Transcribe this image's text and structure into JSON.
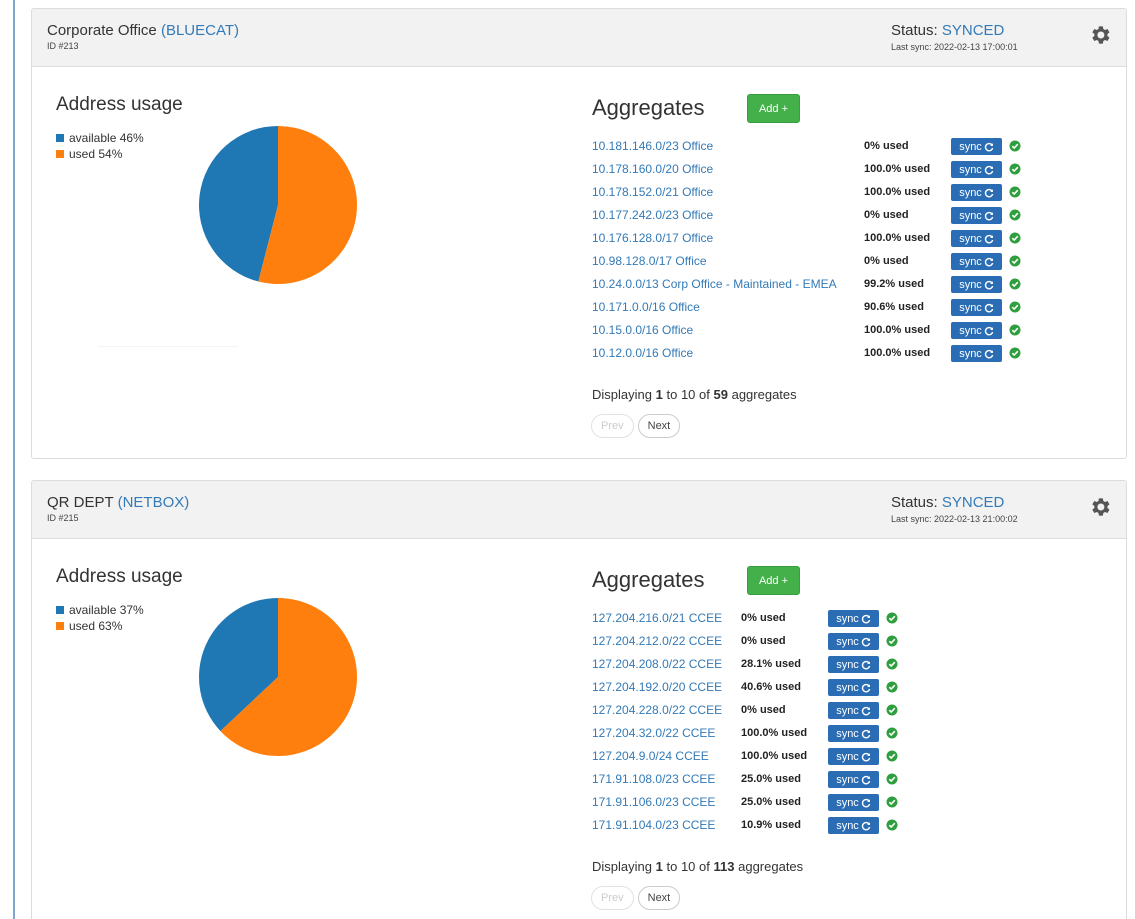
{
  "colors": {
    "available": "#1f77b4",
    "used": "#ff7f0e",
    "link": "#337ab7",
    "add": "#43b04a",
    "sync": "#2a6db5",
    "ok": "#2e9e3e"
  },
  "sites": [
    {
      "title": "Corporate Office",
      "source": "(BLUECAT)",
      "id": "ID #213",
      "status_label": "Status:",
      "status": "SYNCED",
      "last_sync": "Last sync: 2022-02-13 17:00:01",
      "usage_title": "Address usage",
      "legend": [
        {
          "label": "available 46%",
          "color": "#1f77b4"
        },
        {
          "label": "used 54%",
          "color": "#ff7f0e"
        }
      ],
      "chart_data": {
        "type": "pie",
        "slices": [
          {
            "label": "available",
            "value": 46
          },
          {
            "label": "used",
            "value": 54
          }
        ]
      },
      "aggregates_title": "Aggregates",
      "add_label": "Add +",
      "aggregates": [
        {
          "name": "10.181.146.0/23 Office",
          "used": "0% used"
        },
        {
          "name": "10.178.160.0/20 Office",
          "used": "100.0% used"
        },
        {
          "name": "10.178.152.0/21 Office",
          "used": "100.0% used"
        },
        {
          "name": "10.177.242.0/23 Office",
          "used": "0% used"
        },
        {
          "name": "10.176.128.0/17 Office",
          "used": "100.0% used"
        },
        {
          "name": "10.98.128.0/17 Office",
          "used": "0% used"
        },
        {
          "name": "10.24.0.0/13 Corp Office - Maintained - EMEA",
          "used": "99.2% used"
        },
        {
          "name": "10.171.0.0/16 Office",
          "used": "90.6% used"
        },
        {
          "name": "10.15.0.0/16 Office",
          "used": "100.0% used"
        },
        {
          "name": "10.12.0.0/16 Office",
          "used": "100.0% used"
        }
      ],
      "sync_label": "sync",
      "paging": {
        "prefix": "Displaying",
        "from": "1",
        "to_word": "to",
        "to": "10",
        "of_word": "of",
        "total": "59",
        "suffix": "aggregates"
      },
      "prev_label": "Prev",
      "next_label": "Next"
    },
    {
      "title": "QR DEPT",
      "source": "(NETBOX)",
      "id": "ID #215",
      "status_label": "Status:",
      "status": "SYNCED",
      "last_sync": "Last sync: 2022-02-13 21:00:02",
      "usage_title": "Address usage",
      "legend": [
        {
          "label": "available 37%",
          "color": "#1f77b4"
        },
        {
          "label": "used 63%",
          "color": "#ff7f0e"
        }
      ],
      "chart_data": {
        "type": "pie",
        "slices": [
          {
            "label": "available",
            "value": 37
          },
          {
            "label": "used",
            "value": 63
          }
        ]
      },
      "aggregates_title": "Aggregates",
      "add_label": "Add +",
      "aggregates": [
        {
          "name": "127.204.216.0/21 CCEE",
          "used": "0% used"
        },
        {
          "name": "127.204.212.0/22 CCEE",
          "used": "0% used"
        },
        {
          "name": "127.204.208.0/22 CCEE",
          "used": "28.1% used"
        },
        {
          "name": "127.204.192.0/20 CCEE",
          "used": "40.6% used"
        },
        {
          "name": "127.204.228.0/22 CCEE",
          "used": "0% used"
        },
        {
          "name": "127.204.32.0/22 CCEE",
          "used": "100.0% used"
        },
        {
          "name": "127.204.9.0/24 CCEE",
          "used": "100.0% used"
        },
        {
          "name": "171.91.108.0/23 CCEE",
          "used": "25.0% used"
        },
        {
          "name": "171.91.106.0/23 CCEE",
          "used": "25.0% used"
        },
        {
          "name": "171.91.104.0/23 CCEE",
          "used": "10.9% used"
        }
      ],
      "sync_label": "sync",
      "paging": {
        "prefix": "Displaying",
        "from": "1",
        "to_word": "to",
        "to": "10",
        "of_word": "of",
        "total": "113",
        "suffix": "aggregates"
      },
      "prev_label": "Prev",
      "next_label": "Next"
    }
  ]
}
